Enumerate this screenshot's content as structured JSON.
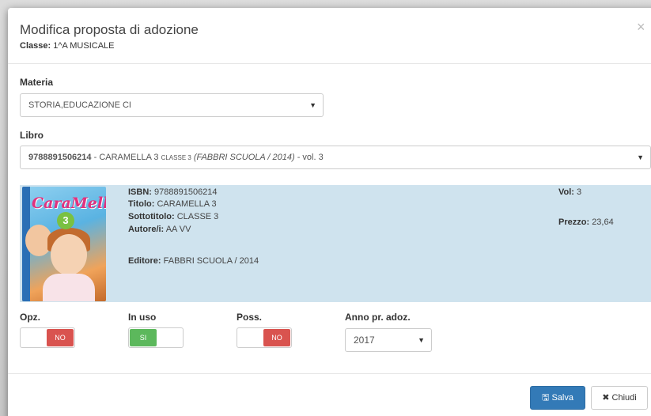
{
  "modal": {
    "title": "Modifica proposta di adozione",
    "class_label": "Classe:",
    "class_value": "1^A MUSICALE",
    "close_glyph": "×"
  },
  "materia": {
    "label": "Materia",
    "selected": "STORIA,EDUCAZIONE CI",
    "caret": "▼"
  },
  "libro": {
    "label": "Libro",
    "isbn": "9788891506214",
    "separator": " - ",
    "title": "CARAMELLA 3",
    "subtitle_small": "CLASSE 3",
    "publisher": "(FABBRI SCUOLA / 2014)",
    "volume": " - vol. 3",
    "caret": "▼"
  },
  "book": {
    "cover_title": "CaraMella",
    "cover_number": "3",
    "isbn_label": "ISBN:",
    "isbn_value": "9788891506214",
    "titolo_label": "Titolo:",
    "titolo_value": "CARAMELLA 3",
    "sottotitolo_label": "Sottotitolo:",
    "sottotitolo_value": "CLASSE 3",
    "autore_label": "Autore/i:",
    "autore_value": "AA VV",
    "editore_label": "Editore:",
    "editore_value": "FABBRI SCUOLA / 2014",
    "vol_label": "Vol:",
    "vol_value": "3",
    "prezzo_label": "Prezzo:",
    "prezzo_value": "23,64"
  },
  "options": {
    "opz_label": "Opz.",
    "opz_value": "NO",
    "inuso_label": "In uso",
    "inuso_value": "SI",
    "poss_label": "Poss.",
    "poss_value": "NO",
    "anno_label": "Anno pr. adoz.",
    "anno_value": "2017",
    "anno_caret": "▼"
  },
  "footer": {
    "save_icon": "🖫",
    "save_label": "Salva",
    "close_icon": "✖",
    "close_label": "Chiudi"
  },
  "colors": {
    "primary": "#337ab7",
    "danger": "#d9534f",
    "success": "#5cb85c",
    "panel": "#cfe3ee"
  }
}
